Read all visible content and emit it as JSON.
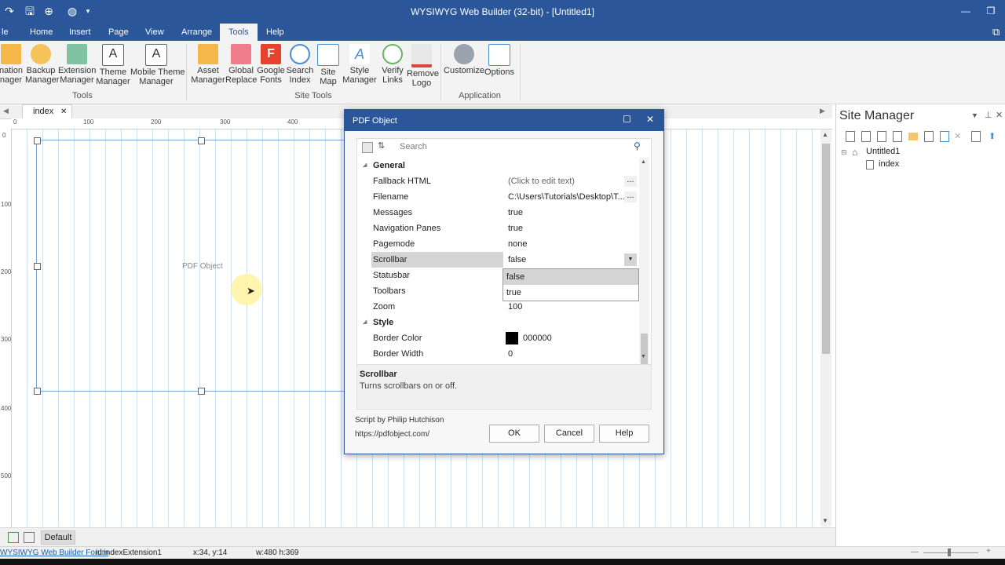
{
  "window": {
    "title": "WYSIWYG Web Builder (32-bit) - [Untitled1]"
  },
  "ribbon_tabs": [
    "le",
    "Home",
    "Insert",
    "Page",
    "View",
    "Arrange",
    "Tools",
    "Help"
  ],
  "ribbon": {
    "tools_group": {
      "label": "Tools",
      "buttons": [
        "nation\nnager",
        "Backup\nManager",
        "Extension\nManager",
        "Theme\nManager",
        "Mobile Theme\nManager"
      ]
    },
    "site_tools_group": {
      "label": "Site Tools",
      "buttons": [
        "Asset\nManager",
        "Global\nReplace",
        "Google\nFonts",
        "Search\nIndex",
        "Site\nMap",
        "Style\nManager",
        "Verify\nLinks",
        "Remove\nLogo"
      ]
    },
    "application_group": {
      "label": "Application",
      "buttons": [
        "Customize",
        "Options"
      ]
    }
  },
  "doc_tab": {
    "label": "index",
    "close": "✕"
  },
  "ruler": {
    "h_ticks": [
      "0",
      "100",
      "200",
      "300",
      "400"
    ],
    "v_ticks": [
      "0",
      "100",
      "200",
      "300",
      "400",
      "500"
    ]
  },
  "canvas": {
    "object_label": "PDF Object"
  },
  "site_manager": {
    "title": "Site Manager",
    "tree_root": "Untitled1",
    "tree_child": "index"
  },
  "bottom": {
    "layer": "Default"
  },
  "statusbar": {
    "forum": "WYSIWYG Web Builder Forum",
    "id": "id:indexExtension1",
    "pos": "x:34, y:14",
    "size": "w:480 h:369"
  },
  "dialog": {
    "title": "PDF Object",
    "search_placeholder": "Search",
    "sections": {
      "general": "General",
      "style": "Style"
    },
    "props": {
      "fallback_html": {
        "name": "Fallback HTML",
        "value": "(Click to edit text)"
      },
      "filename": {
        "name": "Filename",
        "value": "C:\\Users\\Tutorials\\Desktop\\T..."
      },
      "messages": {
        "name": "Messages",
        "value": "true"
      },
      "navigation_panes": {
        "name": "Navigation Panes",
        "value": "true"
      },
      "pagemode": {
        "name": "Pagemode",
        "value": "none"
      },
      "scrollbar": {
        "name": "Scrollbar",
        "value": "false"
      },
      "statusbar": {
        "name": "Statusbar",
        "value": ""
      },
      "toolbars": {
        "name": "Toolbars",
        "value": ""
      },
      "zoom": {
        "name": "Zoom",
        "value": "100"
      },
      "border_color": {
        "name": "Border Color",
        "value": "000000",
        "swatch": "#000000"
      },
      "border_width": {
        "name": "Border Width",
        "value": "0"
      }
    },
    "dropdown_options": [
      "false",
      "true"
    ],
    "description": {
      "title": "Scrollbar",
      "text": "Turns scrollbars on or off."
    },
    "credit": "Script by Philip Hutchison",
    "url": "https://pdfobject.com/",
    "buttons": {
      "ok": "OK",
      "cancel": "Cancel",
      "help": "Help"
    }
  },
  "colors": {
    "accent": "#2b579a",
    "cursor_highlight": "#fff3a0"
  }
}
